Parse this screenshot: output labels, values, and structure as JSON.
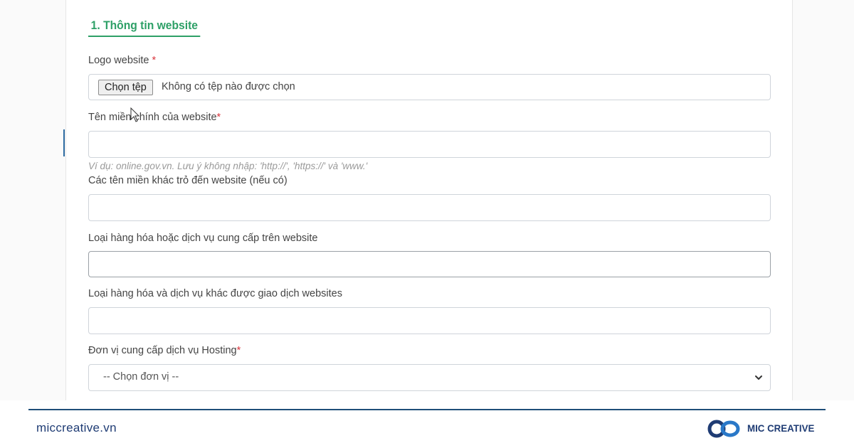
{
  "section": {
    "title": "1. Thông tin website"
  },
  "fields": {
    "logo": {
      "label": "Logo website ",
      "required_mark": "*",
      "button_label": "Chọn tệp",
      "file_status": "Không có tệp nào được chọn"
    },
    "main_domain": {
      "label": "Tên miền chính của website",
      "required_mark": "*",
      "value": "",
      "hint": "Ví dụ: online.gov.vn. Lưu ý không nhập: 'http://', 'https://' và 'www.'"
    },
    "other_domains": {
      "label": "Các tên miền khác trỏ đến website (nếu có)",
      "value": ""
    },
    "goods_types": {
      "label": "Loại hàng hóa hoặc dịch vụ cung cấp trên website",
      "value": ""
    },
    "other_goods": {
      "label": "Loại hàng hóa và dịch vụ khác được giao dịch websites",
      "value": ""
    },
    "hosting": {
      "label": "Đơn vị cung cấp dịch vụ Hosting",
      "required_mark": "*",
      "selected": "-- Chọn đơn vị --"
    }
  },
  "footer": {
    "site": "miccreative.vn",
    "brand": "MIC CREATIVE"
  },
  "colors": {
    "section_green": "#2ea067",
    "required_red": "#d9363e",
    "brand_navy": "#1f3c74",
    "divider_blue": "#1f4e79",
    "logo_blue": "#2a78c8"
  },
  "icons": {
    "select_arrow": "chevron-down-icon",
    "cursor": "mouse-pointer-icon",
    "brand": "infinity-logo"
  }
}
